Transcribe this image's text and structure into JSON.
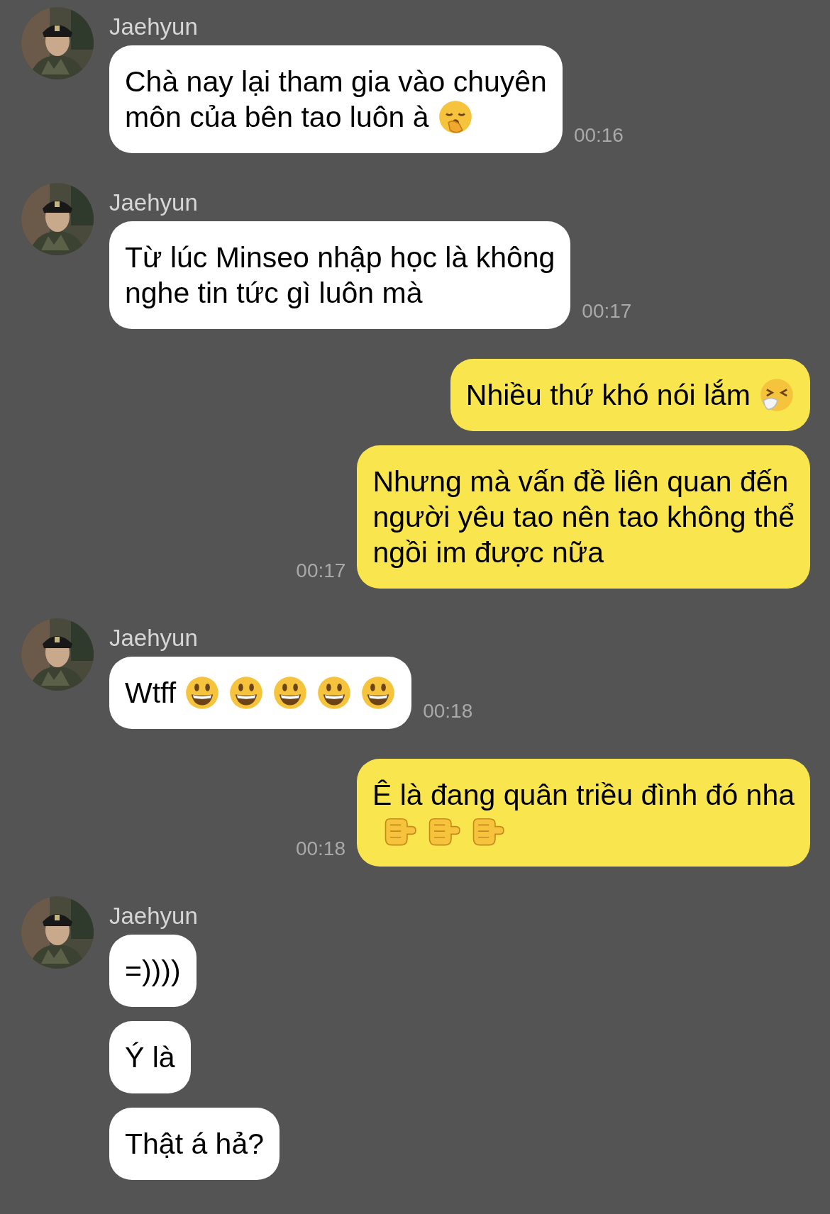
{
  "messages": [
    {
      "outgoing": false,
      "sender": "Jaehyun",
      "bubbles": [
        {
          "lines": [
            {
              "text": "Chà nay lại tham gia vào chuyên"
            },
            {
              "text": "môn của bên tao luôn à",
              "emoji": [
                {
                  "kind": "yawn"
                }
              ]
            }
          ],
          "time": "00:16"
        }
      ]
    },
    {
      "outgoing": false,
      "sender": "Jaehyun",
      "bubbles": [
        {
          "lines": [
            {
              "text": "Từ lúc Minseo nhập học là không"
            },
            {
              "text": "nghe tin tức gì luôn mà"
            }
          ],
          "time": "00:17"
        }
      ]
    },
    {
      "outgoing": true,
      "bubbles": [
        {
          "lines": [
            {
              "text": "Nhiều thứ khó nói lắm",
              "emoji": [
                {
                  "kind": "sneeze"
                }
              ]
            }
          ]
        },
        {
          "lines": [
            {
              "text": "Nhưng mà vấn đề liên quan đến"
            },
            {
              "text": "người yêu tao nên tao không thể"
            },
            {
              "text": "ngồi im được nữa"
            }
          ],
          "time": "00:17"
        }
      ]
    },
    {
      "outgoing": false,
      "sender": "Jaehyun",
      "bubbles": [
        {
          "lines": [
            {
              "text": "Wtff",
              "emoji": [
                {
                  "kind": "grin"
                },
                {
                  "kind": "grin"
                },
                {
                  "kind": "grin"
                },
                {
                  "kind": "grin"
                },
                {
                  "kind": "grin"
                }
              ]
            }
          ],
          "time": "00:18"
        }
      ]
    },
    {
      "outgoing": true,
      "bubbles": [
        {
          "lines": [
            {
              "text": "Ê là đang quân triều đình đó nha"
            },
            {
              "emoji": [
                {
                  "kind": "point"
                },
                {
                  "kind": "point"
                },
                {
                  "kind": "point"
                }
              ]
            }
          ],
          "time": "00:18"
        }
      ]
    },
    {
      "outgoing": false,
      "sender": "Jaehyun",
      "bubbles": [
        {
          "lines": [
            {
              "text": "=))))"
            }
          ]
        },
        {
          "lines": [
            {
              "text": "Ý là"
            }
          ]
        },
        {
          "lines": [
            {
              "text": "Thật á hả?"
            }
          ]
        }
      ]
    }
  ]
}
